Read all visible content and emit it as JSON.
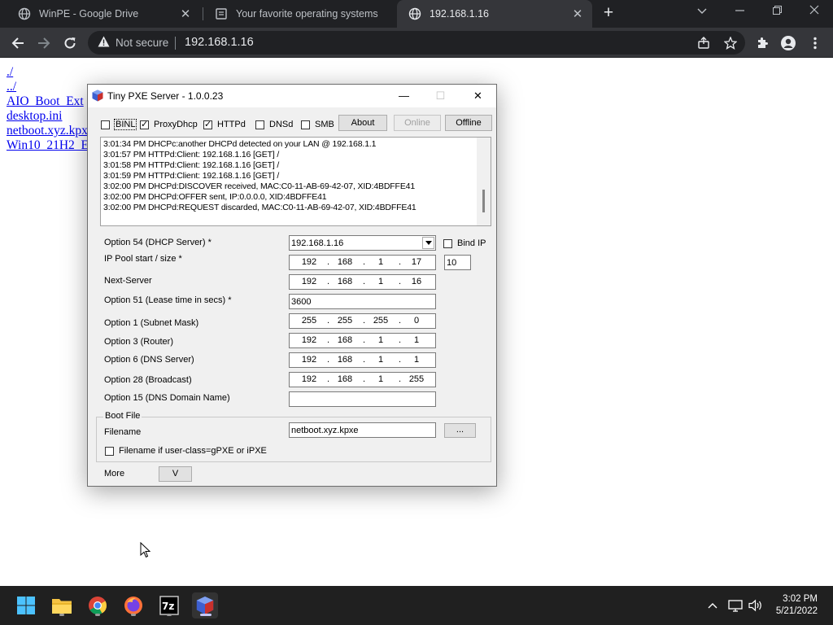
{
  "browser": {
    "tabs": [
      {
        "title": "WinPE - Google Drive",
        "active": false
      },
      {
        "title": "Your favorite operating systems",
        "active": false
      },
      {
        "title": "192.168.1.16",
        "active": true
      }
    ],
    "address": {
      "security_label": "Not secure",
      "url": "192.168.1.16"
    }
  },
  "listing": {
    "links": [
      "./",
      "../",
      "AIO_Boot_Ext",
      "desktop.ini",
      "netboot.xyz.kpx",
      "Win10_21H2_E"
    ]
  },
  "pxe_window": {
    "title": "Tiny PXE Server - 1.0.0.23",
    "options": [
      {
        "label": "BINL",
        "checked": false
      },
      {
        "label": "ProxyDhcp",
        "checked": true
      },
      {
        "label": "HTTPd",
        "checked": true
      },
      {
        "label": "DNSd",
        "checked": false
      },
      {
        "label": "SMB",
        "checked": false
      }
    ],
    "buttons": {
      "about": "About",
      "online": "Online",
      "offline": "Offline"
    },
    "log": [
      "3:01:34 PM DHCPc:another DHCPd detected on your LAN @ 192.168.1.1",
      "3:01:57 PM HTTPd:Client: 192.168.1.16 [GET] /",
      "3:01:58 PM HTTPd:Client: 192.168.1.16 [GET] /",
      "3:01:59 PM HTTPd:Client: 192.168.1.16 [GET] /",
      "3:02:00 PM DHCPd:DISCOVER received, MAC:C0-11-AB-69-42-07, XID:4BDFFE41",
      "3:02:00 PM DHCPd:OFFER sent, IP:0.0.0.0, XID:4BDFFE41",
      "3:02:00 PM DHCPd:REQUEST discarded, MAC:C0-11-AB-69-42-07, XID:4BDFFE41"
    ],
    "fields": {
      "option54": {
        "label": "Option 54 (DHCP Server) *",
        "value": "192.168.1.16"
      },
      "bind_ip": {
        "label": "Bind IP",
        "checked": false
      },
      "pool": {
        "label": "IP Pool start / size *",
        "ip": [
          "192",
          "168",
          "1",
          "17"
        ],
        "size": "10"
      },
      "next_server": {
        "label": "Next-Server",
        "ip": [
          "192",
          "168",
          "1",
          "16"
        ]
      },
      "option51": {
        "label": "Option 51 (Lease time in secs) *",
        "value": "3600"
      },
      "option1": {
        "label": "Option 1  (Subnet Mask)",
        "ip": [
          "255",
          "255",
          "255",
          "0"
        ]
      },
      "option3": {
        "label": "Option 3  (Router)",
        "ip": [
          "192",
          "168",
          "1",
          "1"
        ]
      },
      "option6": {
        "label": "Option 6  (DNS Server)",
        "ip": [
          "192",
          "168",
          "1",
          "1"
        ]
      },
      "option28": {
        "label": "Option 28 (Broadcast)",
        "ip": [
          "192",
          "168",
          "1",
          "255"
        ]
      },
      "option15": {
        "label": "Option 15 (DNS Domain Name)",
        "value": ""
      }
    },
    "boot_file": {
      "group_title": "Boot File",
      "filename_label": "Filename",
      "filename": "netboot.xyz.kpxe",
      "browse_label": "...",
      "user_class_label": "Filename if user-class=gPXE or iPXE",
      "user_class_checked": false
    },
    "more": {
      "label": "More",
      "button": "V"
    }
  },
  "taskbar": {
    "time": "3:02 PM",
    "date": "5/21/2022"
  },
  "icons": [
    "globe-icon",
    "doc-icon",
    "close-icon",
    "new-tab-icon",
    "back-icon",
    "forward-icon",
    "reload-icon",
    "warning-icon",
    "share-icon",
    "star-icon",
    "puzzle-icon",
    "profile-icon",
    "menu-icon",
    "windows-start-icon",
    "file-explorer-icon",
    "chrome-icon",
    "firefox-icon",
    "7zip-icon",
    "tiny-pxe-icon",
    "chevron-up-icon",
    "network-icon",
    "volume-icon"
  ],
  "colors": {
    "link": "#0000ee",
    "browser_dark": "#202124",
    "toolbar": "#35363a",
    "taskbar": "#202020",
    "dialog": "#f0f0f0"
  }
}
